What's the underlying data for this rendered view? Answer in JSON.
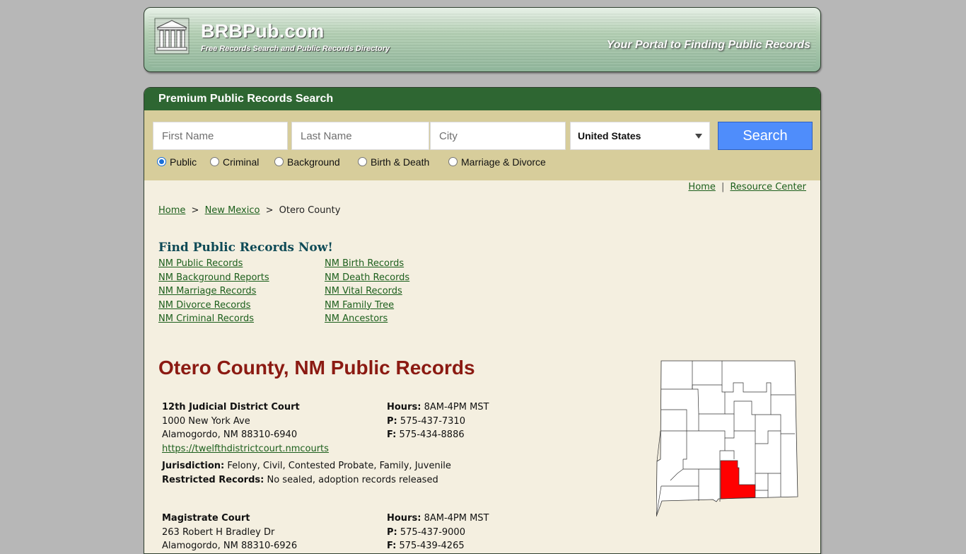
{
  "header": {
    "site_title": "BRBPub.com",
    "site_subtitle": "Free Records Search and Public Records Directory",
    "tagline": "Your Portal to Finding Public Records"
  },
  "search": {
    "panel_title": "Premium Public Records Search",
    "first_name_placeholder": "First Name",
    "last_name_placeholder": "Last Name",
    "city_placeholder": "City",
    "country_selected": "United States",
    "button_label": "Search",
    "radio_options": [
      {
        "label": "Public",
        "selected": true
      },
      {
        "label": "Criminal",
        "selected": false
      },
      {
        "label": "Background",
        "selected": false
      },
      {
        "label": "Birth & Death",
        "selected": false
      },
      {
        "label": "Marriage & Divorce",
        "selected": false
      }
    ]
  },
  "top_links": {
    "home": "Home",
    "separator": "|",
    "resource_center": "Resource Center"
  },
  "breadcrumb": {
    "home": "Home",
    "sep1": ">",
    "state": "New Mexico",
    "sep2": ">",
    "current": "Otero County"
  },
  "find_records": {
    "title": "Find Public Records Now!",
    "left_links": [
      "NM Public Records",
      "NM Background Reports",
      "NM Marriage Records",
      "NM Divorce Records",
      "NM Criminal Records"
    ],
    "right_links": [
      "NM Birth Records",
      "NM Death Records",
      "NM Vital Records",
      "NM Family Tree",
      "NM Ancestors"
    ]
  },
  "county_title": "Otero County, NM Public Records",
  "offices": [
    {
      "name": "12th Judicial District Court",
      "address1": "1000 New York Ave",
      "address2": "Alamogordo, NM 88310-6940",
      "url": "https://twelfthdistrictcourt.nmcourts",
      "hours_label": "Hours:",
      "hours": "8AM-4PM MST",
      "phone_label": "P:",
      "phone": "575-437-7310",
      "fax_label": "F:",
      "fax": "575-434-8886",
      "jurisdiction_label": "Jurisdiction:",
      "jurisdiction": "Felony, Civil, Contested Probate, Family, Juvenile",
      "restricted_label": "Restricted Records:",
      "restricted": "No sealed, adoption records released"
    },
    {
      "name": "Magistrate Court",
      "address1": "263 Robert H Bradley Dr",
      "address2": "Alamogordo, NM 88310-6926",
      "hours_label": "Hours:",
      "hours": "8AM-4PM MST",
      "phone_label": "P:",
      "phone": "575-437-9000",
      "fax_label": "F:",
      "fax": "575-439-4265"
    }
  ],
  "colors": {
    "bar_green": "#2e6632",
    "search_band": "#d7cd9b",
    "panel_bg": "#f4efe0",
    "title_red": "#8b1a12",
    "find_title": "#0e4a56",
    "button_blue": "#4f8dfb",
    "map_highlight": "#ff0000"
  }
}
